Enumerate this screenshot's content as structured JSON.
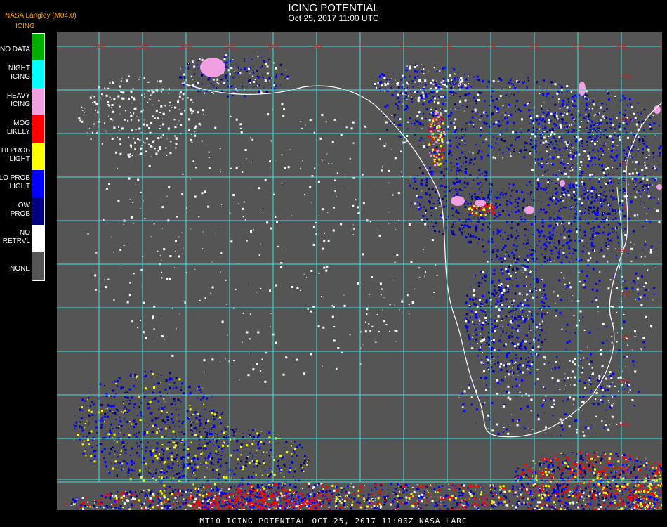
{
  "header": {
    "title": "ICING POTENTIAL",
    "subtitle": "Oct 25, 2017 11:00 UTC",
    "producer": "NASA Langley (M04.0)",
    "legend_title": "ICING"
  },
  "legend": [
    {
      "label": "NO DATA",
      "color": "#00b000"
    },
    {
      "label": "NIGHT\nICING",
      "color": "#00ffff"
    },
    {
      "label": "HEAVY\nICING",
      "color": "#f0a0e0"
    },
    {
      "label": "MOG\nLIKELY",
      "color": "#ff0000"
    },
    {
      "label": "HI PROB\nLIGHT",
      "color": "#ffff00"
    },
    {
      "label": "LO PROB\nLIGHT",
      "color": "#0000ff"
    },
    {
      "label": "LOW\nPROB",
      "color": "#000080"
    },
    {
      "label": "NO\nRETRVL",
      "color": "#ffffff"
    },
    {
      "label": "NONE",
      "color": "#555555"
    }
  ],
  "map": {
    "background": "#555555",
    "grid_color": "#44e0e0",
    "label_color": "#cc2222",
    "coast_color": "#ffffff",
    "lon_labels": [
      "30W",
      "25W",
      "20W",
      "15W",
      "10W",
      "5W",
      "0",
      "5E",
      "10E",
      "15E",
      "20E",
      "25E",
      "30E",
      "35E",
      "40E"
    ],
    "lat_labels": [
      "15N",
      "10N",
      "5N",
      "0",
      "5S",
      "10S",
      "15S",
      "20S",
      "25S",
      "30S",
      "35S"
    ]
  },
  "footer": "MT10  ICING POTENTIAL   OCT 25, 2017 11:00Z   NASA LARC"
}
